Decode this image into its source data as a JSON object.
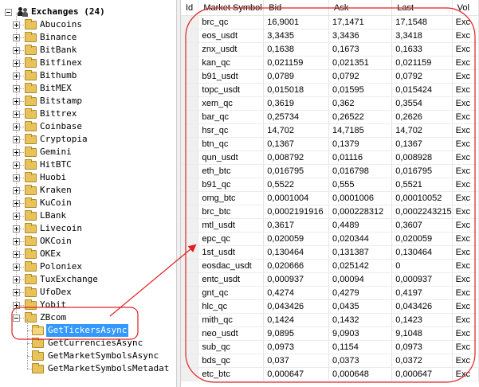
{
  "tree": {
    "root_label": "Exchanges (24)",
    "exchanges": [
      "Abucoins",
      "Binance",
      "BitBank",
      "Bitfinex",
      "Bithumb",
      "BitMEX",
      "Bitstamp",
      "Bittrex",
      "Coinbase",
      "Cryptopia",
      "Gemini",
      "HitBTC",
      "Huobi",
      "Kraken",
      "KuCoin",
      "LBank",
      "Livecoin",
      "OKCoin",
      "OKEx",
      "Poloniex",
      "TuxExchange",
      "UfoDex",
      "Yobit",
      "ZBcom"
    ],
    "zbcom_children": [
      "GetTickersAsync",
      "GetCurrenciesAsync",
      "GetMarketSymbolsAsync",
      "GetMarketSymbolsMetadat"
    ]
  },
  "grid": {
    "columns": [
      "Id",
      "Market Symbol",
      "Bid",
      "Ask",
      "Last",
      "Vol"
    ],
    "rows": [
      [
        "",
        "brc_qc",
        "16,9001",
        "17,1471",
        "17,1548",
        "Exc"
      ],
      [
        "",
        "eos_usdt",
        "3,3435",
        "3,3436",
        "3,3418",
        "Exc"
      ],
      [
        "",
        "znx_usdt",
        "0,1638",
        "0,1673",
        "0,1633",
        "Exc"
      ],
      [
        "",
        "kan_qc",
        "0,021159",
        "0,021351",
        "0,021159",
        "Exc"
      ],
      [
        "",
        "b91_usdt",
        "0,0789",
        "0,0792",
        "0,0792",
        "Exc"
      ],
      [
        "",
        "topc_usdt",
        "0,015018",
        "0,01595",
        "0,015424",
        "Exc"
      ],
      [
        "",
        "xem_qc",
        "0,3619",
        "0,362",
        "0,3554",
        "Exc"
      ],
      [
        "",
        "bar_qc",
        "0,25734",
        "0,26522",
        "0,2626",
        "Exc"
      ],
      [
        "",
        "hsr_qc",
        "14,702",
        "14,7185",
        "14,702",
        "Exc"
      ],
      [
        "",
        "btn_qc",
        "0,1367",
        "0,1379",
        "0,1367",
        "Exc"
      ],
      [
        "",
        "qun_usdt",
        "0,008792",
        "0,01116",
        "0,008928",
        "Exc"
      ],
      [
        "",
        "eth_btc",
        "0,016795",
        "0,016798",
        "0,016795",
        "Exc"
      ],
      [
        "",
        "b91_qc",
        "0,5522",
        "0,555",
        "0,5521",
        "Exc"
      ],
      [
        "",
        "omg_btc",
        "0,0001004",
        "0,0001006",
        "0,00010052",
        "Exc"
      ],
      [
        "",
        "brc_btc",
        "0,0002191916",
        "0,000228312",
        "0,0002243215",
        "Exc"
      ],
      [
        "",
        "mtl_usdt",
        "0,3617",
        "0,4489",
        "0,3607",
        "Exc"
      ],
      [
        "",
        "epc_qc",
        "0,020059",
        "0,020344",
        "0,020059",
        "Exc"
      ],
      [
        "",
        "1st_usdt",
        "0,130464",
        "0,131387",
        "0,130464",
        "Exc"
      ],
      [
        "",
        "eosdac_usdt",
        "0,020666",
        "0,025142",
        "0",
        "Exc"
      ],
      [
        "",
        "entc_usdt",
        "0,000937",
        "0,00094",
        "0,000937",
        "Exc"
      ],
      [
        "",
        "gnt_qc",
        "0,4274",
        "0,4279",
        "0,4197",
        "Exc"
      ],
      [
        "",
        "hlc_qc",
        "0,043426",
        "0,0435",
        "0,043426",
        "Exc"
      ],
      [
        "",
        "mith_qc",
        "0,1424",
        "0,1432",
        "0,1423",
        "Exc"
      ],
      [
        "",
        "neo_usdt",
        "9,0895",
        "9,0903",
        "9,1048",
        "Exc"
      ],
      [
        "",
        "sub_qc",
        "0,0973",
        "0,1154",
        "0,0973",
        "Exc"
      ],
      [
        "",
        "bds_qc",
        "0,037",
        "0,0373",
        "0,0372",
        "Exc"
      ],
      [
        "",
        "etc_btc",
        "0,000647",
        "0,000648",
        "0,000647",
        "Exc"
      ]
    ]
  },
  "colors": {
    "selection": "#3399ff",
    "annotation": "#e02020",
    "folder": "#e8c25a"
  }
}
